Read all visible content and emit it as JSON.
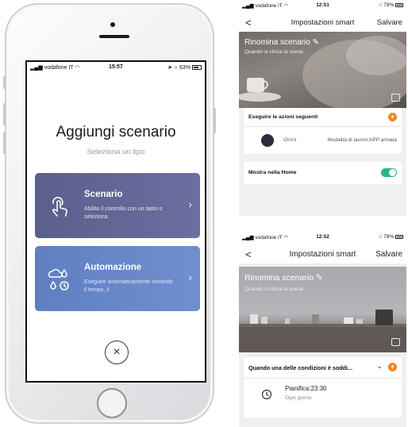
{
  "colors": {
    "scenario_card": "#5a5f8c",
    "automation_card": "#5f7fc0",
    "accent_orange": "#f5841f",
    "toggle_green": "#2db38a"
  },
  "phone": {
    "statusbar": {
      "carrier": "vodafone IT",
      "time": "15:57",
      "battery": "63%"
    },
    "title": "Aggiungi scenario",
    "subtitle": "Seleziona un tipo",
    "cards": [
      {
        "title": "Scenario",
        "description": "Abilita il controllo con un tasto o seleziona",
        "icon": "tap-hand-icon"
      },
      {
        "title": "Automazione",
        "description": "Eseguire automaticamente secondo il tempo, il",
        "icon": "weather-clock-icon"
      }
    ],
    "close_glyph": "×"
  },
  "smart_top": {
    "statusbar": {
      "carrier": "vodafone IT",
      "time": "12:51",
      "battery": "79%"
    },
    "nav": {
      "back": "<",
      "title": "Impostazioni smart",
      "save": "Salvare"
    },
    "banner": {
      "title": "Rinomina scenario",
      "subtitle": "Quando si clicca la scena"
    },
    "actions_header": "Eseguire le azioni seguenti",
    "action": {
      "device": "Omni",
      "mode": "Modalità di lavoro:APP armata"
    },
    "show_home_label": "Mostra nella Home",
    "show_home_enabled": true
  },
  "smart_bottom": {
    "statusbar": {
      "carrier": "vodafone IT",
      "time": "12:52",
      "battery": "79%"
    },
    "nav": {
      "back": "<",
      "title": "Impostazioni smart",
      "save": "Salvare"
    },
    "banner": {
      "title": "Rinomina scenario",
      "subtitle": "Quando si clicca la scena"
    },
    "condition_header": "Quando una delle condizioni è soddi...",
    "schedule": {
      "title": "Pianifica:23:30",
      "subtitle": "Ogni giorno"
    }
  }
}
